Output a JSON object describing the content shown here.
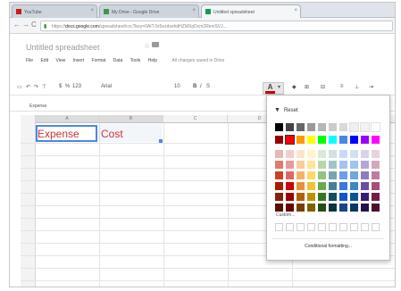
{
  "browser": {
    "tabs": [
      {
        "label": "YouTube",
        "active": false
      },
      {
        "label": "My Drive - Google Drive",
        "active": false
      },
      {
        "label": "Untitled spreadsheet",
        "active": true
      }
    ],
    "back_icon": "back-arrow-icon",
    "forward_icon": "forward-arrow-icon",
    "reload_icon": "reload-icon",
    "url_prefix": "https://",
    "url_host": "docs.google.com",
    "url_path": "/spreadsheet/ccc?key=0AtT-5r5ezdxehdHZMXpDcm2ReniSVJ..."
  },
  "doc": {
    "title": "Untitled spreadsheet",
    "menu": [
      "File",
      "Edit",
      "View",
      "Insert",
      "Format",
      "Data",
      "Tools",
      "Help"
    ],
    "status": "All changes saved in Drive"
  },
  "toolbar": {
    "percent": "%",
    "decimals": "123",
    "font": "Arial",
    "size": "10",
    "bold": "B",
    "italic": "I",
    "text_color_letter": "A"
  },
  "formula_bar": {
    "content": "Expense"
  },
  "grid": {
    "columns": [
      "A",
      "B",
      "C",
      "D",
      "E"
    ],
    "cells": {
      "A1": "Expense",
      "B1": "Cost"
    }
  },
  "palette": {
    "reset_label": "Reset",
    "custom_label": "Custom...",
    "conditional_label": "Conditional formatting...",
    "colors": {
      "grays": [
        "#000000",
        "#434343",
        "#666666",
        "#999999",
        "#b7b7b7",
        "#cccccc",
        "#d9d9d9",
        "#efefef",
        "#f3f3f3",
        "#ffffff"
      ],
      "brights": [
        "#980000",
        "#ff0000",
        "#ff9900",
        "#ffff00",
        "#00ff00",
        "#00ffff",
        "#4a86e8",
        "#0000ff",
        "#9900ff",
        "#ff00ff"
      ],
      "shades": [
        [
          "#e6b8af",
          "#f4cccc",
          "#fce5cd",
          "#fff2cc",
          "#d9ead3",
          "#d0e0e3",
          "#c9daf8",
          "#cfe2f3",
          "#d9d2e9",
          "#ead1dc"
        ],
        [
          "#dd7e6b",
          "#ea9999",
          "#f9cb9c",
          "#ffe599",
          "#b6d7a8",
          "#a2c4c9",
          "#a4c2f4",
          "#9fc5e8",
          "#b4a7d6",
          "#d5a6bd"
        ],
        [
          "#cc4125",
          "#e06666",
          "#f6b26b",
          "#ffd966",
          "#93c47d",
          "#76a5af",
          "#6d9eeb",
          "#6fa8dc",
          "#8e7cc3",
          "#c27ba0"
        ],
        [
          "#a61c00",
          "#cc0000",
          "#e69138",
          "#f1c232",
          "#6aa84f",
          "#45818e",
          "#3c78d8",
          "#3d85c6",
          "#674ea7",
          "#a64d79"
        ],
        [
          "#85200c",
          "#990000",
          "#b45f06",
          "#bf9000",
          "#38761d",
          "#134f5c",
          "#1155cc",
          "#0b5394",
          "#351c75",
          "#741b47"
        ],
        [
          "#5b0f00",
          "#660000",
          "#783f04",
          "#7f6000",
          "#274e13",
          "#0c343d",
          "#1c4587",
          "#073763",
          "#20124d",
          "#4c1130"
        ]
      ]
    }
  }
}
